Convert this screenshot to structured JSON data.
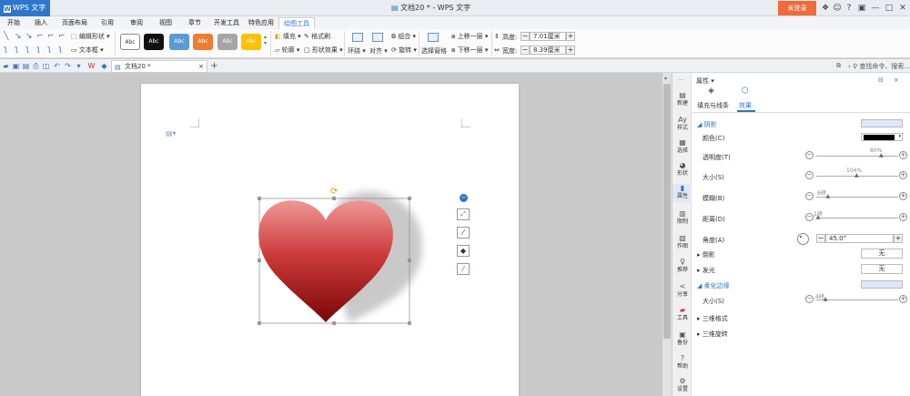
{
  "titlebar": {
    "app_name": "WPS 文字",
    "doc_title": "文档20 * - WPS 文字",
    "login_label": "未登录"
  },
  "menu": {
    "tabs": [
      "开始",
      "插入",
      "页面布局",
      "引用",
      "审阅",
      "视图",
      "章节",
      "开发工具",
      "特色应用",
      "绘图工具"
    ],
    "active_tab": "绘图工具"
  },
  "ribbon": {
    "edit_shape": "编辑形状",
    "text_box": "文本框",
    "style_label": "Abc",
    "fill": "填充",
    "format_brush": "格式刷",
    "outline": "轮廓",
    "shape_effect": "形状效果",
    "wrap": "环绕",
    "align": "对齐",
    "group": "组合",
    "rotate": "旋转",
    "selection_pane": "选择窗格",
    "bring_forward": "上移一层",
    "send_backward": "下移一层",
    "height_label": "高度:",
    "height_value": "7.01厘米",
    "width_label": "宽度:",
    "width_value": "8.39厘米",
    "search_hint": "查找命令、搜索..."
  },
  "docbar": {
    "tab_name": "文档20 *"
  },
  "colors": {
    "accent": "#2e76c9",
    "login": "#f06a3a",
    "heart_top": "#ee8a8a",
    "heart_bottom": "#8a0a0a",
    "shadow": "#c4c4c4"
  },
  "strip": [
    "新建",
    "样式",
    "选择",
    "形状",
    "属性",
    "限制",
    "分享",
    "作图",
    "推荐",
    "分享",
    "工具",
    "备份",
    "帮助",
    "设置"
  ],
  "panel": {
    "title": "属性",
    "tab_fill": "填充与线条",
    "tab_effect": "效果",
    "shadow_section": "阴影",
    "color_label": "颜色(C)",
    "transparency_label": "透明度(T)",
    "transparency_value": "80%",
    "transparency_level": 0.8,
    "size_label": "大小(S)",
    "size_value": "104%",
    "size_level": 0.5,
    "blur_label": "模糊(B)",
    "blur_value": "6磅",
    "blur_level": 0.15,
    "distance_label": "距离(D)",
    "distance_value": "1磅",
    "distance_level": 0.03,
    "angle_label": "角度(A)",
    "angle_value": "45.0°",
    "reflection_label": "倒影",
    "reflection_value": "无",
    "glow_label": "发光",
    "glow_value": "无",
    "soft_edge_label": "柔化边缘",
    "soft_size_label": "大小(S)",
    "soft_size_value": "4磅",
    "soft_size_level": 0.12,
    "three_d_format": "三维格式",
    "three_d_rotation": "三维旋转"
  }
}
